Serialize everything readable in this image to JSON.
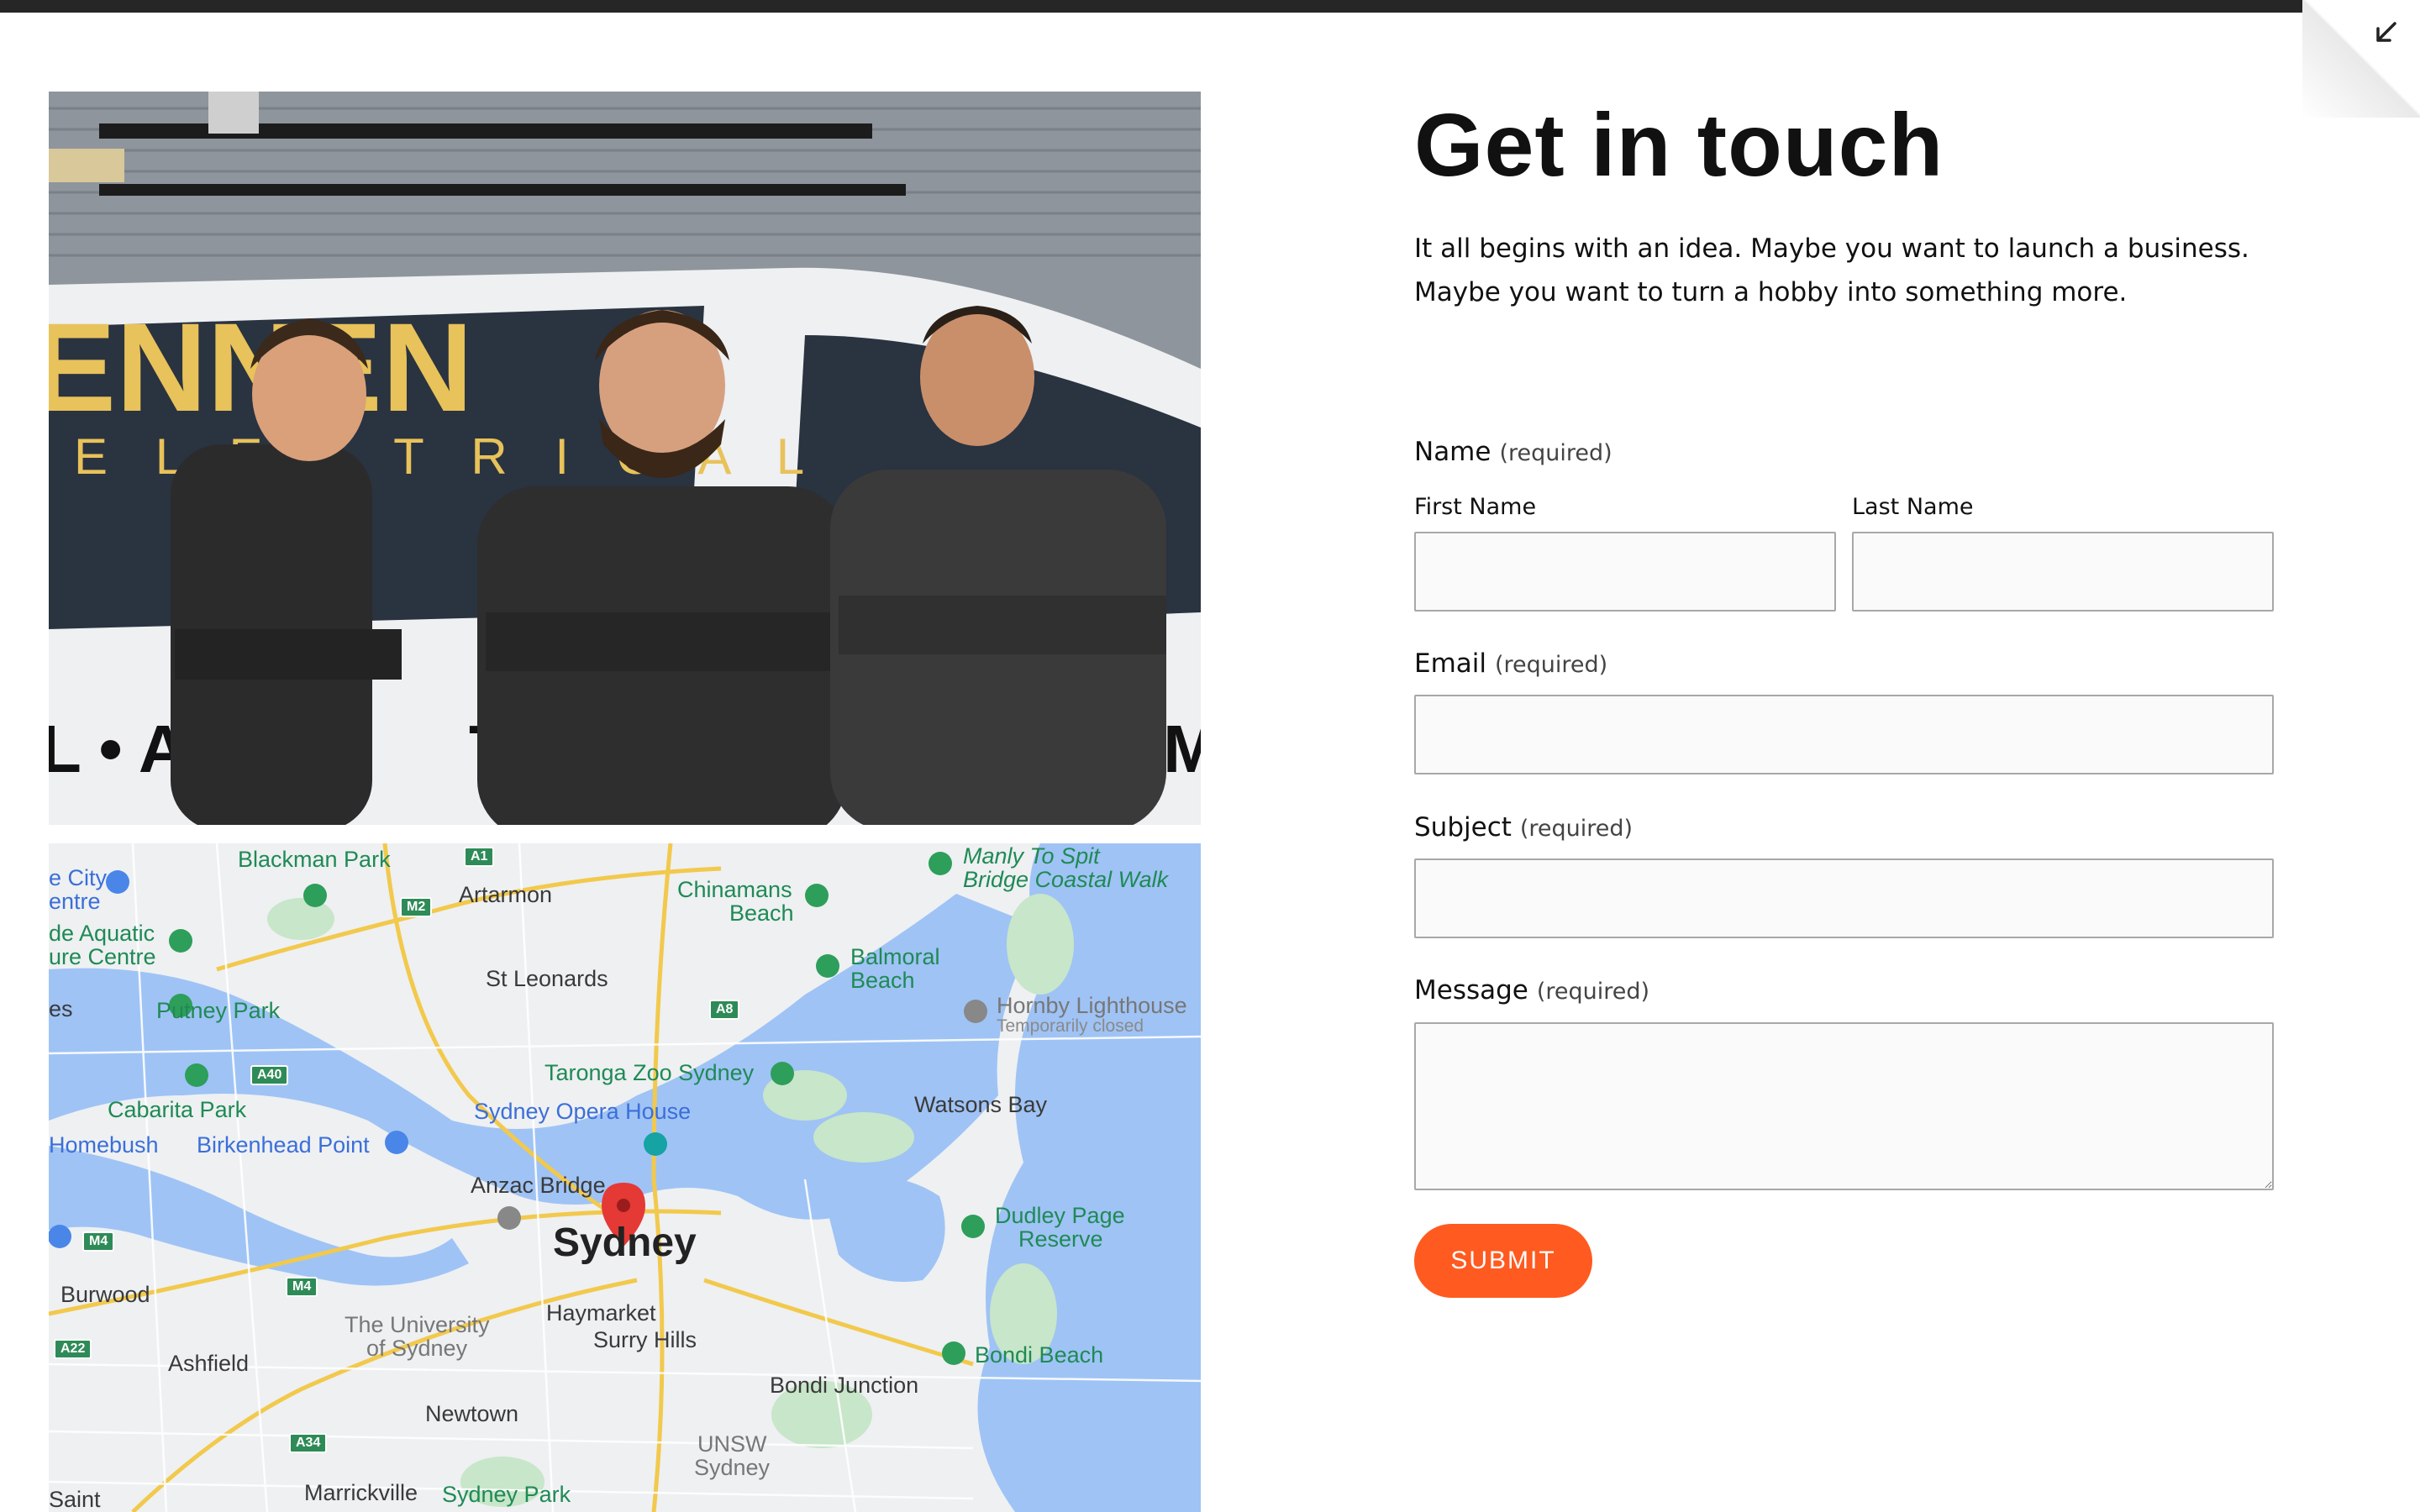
{
  "contact": {
    "title": "Get in touch",
    "intro_line1": "It all begins with an idea. Maybe you want to launch a business.",
    "intro_line2": "Maybe you want to turn a hobby into something more.",
    "name_label": "Name",
    "name_required": "(required)",
    "first_name_label": "First Name",
    "last_name_label": "Last Name",
    "email_label": "Email",
    "email_required": "(required)",
    "subject_label": "Subject",
    "subject_required": "(required)",
    "message_label": "Message",
    "message_required": "(required)",
    "first_name_value": "",
    "last_name_value": "",
    "email_value": "",
    "subject_value": "",
    "message_value": "",
    "submit_label": "SUBMIT"
  },
  "photo": {
    "van_text_top": "ENNEN",
    "van_text_mid": "E L E C T R I C A L",
    "van_text_bottom_left": "L • AIR",
    "van_text_bottom_mid": "TI",
    "van_text_bottom_right": "ENM"
  },
  "map": {
    "labels": [
      "Blackman Park",
      "Artarmon",
      "Chinamans",
      "Beach",
      "Manly To Spit",
      "Bridge Coastal Walk",
      "e City",
      "entre",
      "de Aquatic",
      "ure Centre",
      "St Leonards",
      "Balmoral",
      "Beach",
      "Hornby Lighthouse",
      "Temporarily closed",
      "es",
      "Putney Park",
      "Taronga Zoo Sydney",
      "Watsons Bay",
      "Cabarita Park",
      "Sydney Opera House",
      "Homebush",
      "Birkenhead Point",
      "Anzac Bridge",
      "Dudley Page",
      "Reserve",
      "Sydney",
      "Burwood",
      "Haymarket",
      "The University",
      "of Sydney",
      "Surry Hills",
      "Bondi Beach",
      "Ashfield",
      "Bondi Junction",
      "Newtown",
      "UNSW",
      "Sydney",
      "Saint",
      "Marrickville",
      "Sydney Park"
    ],
    "shields": [
      "A1",
      "M2",
      "A8",
      "A40",
      "M4",
      "M4",
      "A22",
      "A34"
    ]
  },
  "colors": {
    "accent": "#ff5a1f",
    "water": "#9fc3f5",
    "park": "#c8e6c9",
    "topbar": "#262626"
  },
  "icons": {
    "collapse": "arrow-down-left-icon",
    "map_pin": "red-map-pin-icon"
  }
}
